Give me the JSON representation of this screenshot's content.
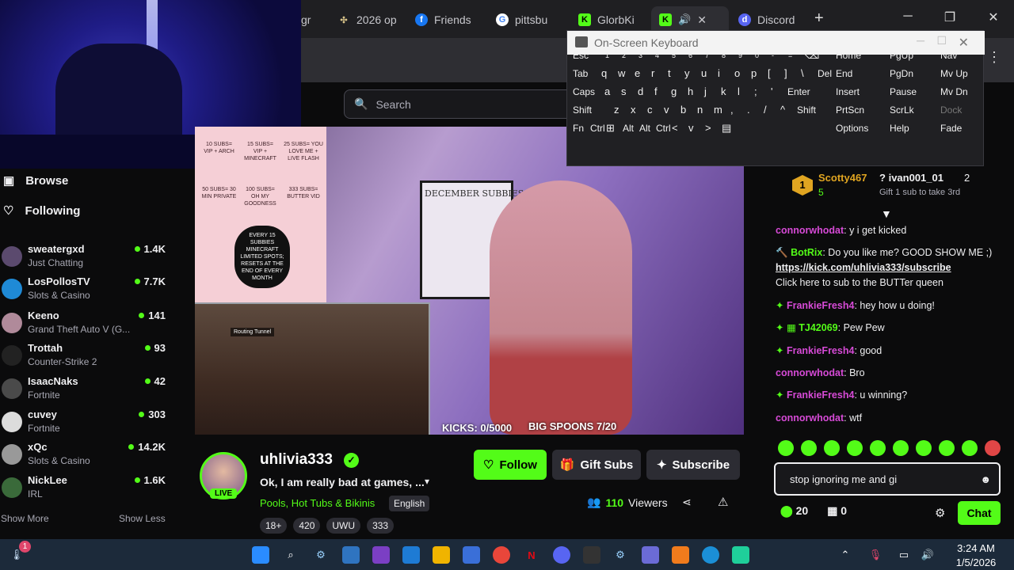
{
  "browser": {
    "tabs": [
      {
        "label": "gr",
        "icon": "page-icon"
      },
      {
        "label": "2026 op",
        "icon": "compass-icon"
      },
      {
        "label": "Friends",
        "icon": "facebook-icon"
      },
      {
        "label": "pittsbu",
        "icon": "google-icon"
      },
      {
        "label": "GlorbKi",
        "icon": "kick-icon"
      },
      {
        "label": "",
        "icon": "kick-icon",
        "active": true
      },
      {
        "label": "Discord",
        "icon": "discord-icon"
      }
    ],
    "new_tab": "+",
    "window_controls": [
      "─",
      "❐",
      "✕"
    ]
  },
  "site": {
    "search_placeholder": "Search"
  },
  "sidebar": {
    "browse": "Browse",
    "following": "Following",
    "channels": [
      {
        "name": "sweatergxd",
        "category": "Just Chatting",
        "viewers": "1.4K",
        "color": "#5b4a6e"
      },
      {
        "name": "LosPollosTV",
        "category": "Slots & Casino",
        "viewers": "7.7K",
        "color": "#1f8ad6"
      },
      {
        "name": "Keeno",
        "category": "Grand Theft Auto V (G...",
        "viewers": "141",
        "color": "#b08a9a"
      },
      {
        "name": "Trottah",
        "category": "Counter-Strike 2",
        "viewers": "93",
        "color": "#222222"
      },
      {
        "name": "IsaacNaks",
        "category": "Fortnite",
        "viewers": "42",
        "color": "#4a4a4a"
      },
      {
        "name": "cuvey",
        "category": "Fortnite",
        "viewers": "303",
        "color": "#dcdcdc"
      },
      {
        "name": "xQc",
        "category": "Slots & Casino",
        "viewers": "14.2K",
        "color": "#999999"
      },
      {
        "name": "NickLee",
        "category": "IRL",
        "viewers": "1.6K",
        "color": "#3a6a3a"
      }
    ],
    "show_more": "Show More",
    "show_less": "Show Less"
  },
  "video_overlay": {
    "kicks": "KICKS: 0/5000",
    "spoons": "BIG SPOONS 7/20",
    "board_title": "DECEMBER SUBBIES",
    "game_label": "Routing Tunnel",
    "hearts": [
      "10 SUBS= VIP + ARCH",
      "15 SUBS= VIP + MINECRAFT",
      "25 SUBS= YOU LOVE ME + LIVE FLASH",
      "50 SUBS= 30 MIN PRIVATE",
      "100 SUBS= OH MY GOODNESS",
      "333 SUBS= BUTTER VID",
      "EVERY 15 SUBBIES MINECRAFT LIMITED SPOTS; RESETS AT THE END OF EVERY MONTH"
    ]
  },
  "stream": {
    "streamer": "uhlivia333",
    "live_badge": "LIVE",
    "title": "Ok, I am really bad at games, ...",
    "category": "Pools, Hot Tubs & Bikinis",
    "language": "English",
    "tags": [
      "18+",
      "420",
      "UWU",
      "333"
    ],
    "follow": "Follow",
    "gift_subs": "Gift Subs",
    "subscribe": "Subscribe",
    "viewers_count": "110",
    "viewers_label": "Viewers"
  },
  "chat": {
    "leaderboard": [
      {
        "name": "Scotty467",
        "rank": "1",
        "count": "5"
      },
      {
        "name": "ivan001_01",
        "count": "2"
      }
    ],
    "gift_prompt": "Gift 1 sub to take 3rd",
    "messages": [
      {
        "user": "connorwhodat",
        "text": "y i get kicked",
        "color": "#d64ad6"
      },
      {
        "user": "BotRix",
        "text": "Do you like me? GOOD SHOW ME ;)",
        "link": "https://kick.com/uhlivia333/subscribe",
        "extra": "Click here to sub to the BUTTer queen",
        "color": "#53fc18"
      },
      {
        "user": "FrankieFresh4",
        "text": "hey how u doing!",
        "color": "#d64ad6"
      },
      {
        "user": "TJ42069",
        "text": "Pew Pew",
        "color": "#53fc18"
      },
      {
        "user": "FrankieFresh4",
        "text": "good",
        "color": "#d64ad6"
      },
      {
        "user": "connorwhodat",
        "text": "Bro",
        "color": "#d64ad6"
      },
      {
        "user": "FrankieFresh4",
        "text": "u winning?",
        "color": "#d64ad6"
      },
      {
        "user": "connorwhodat",
        "text": "wtf",
        "color": "#d64ad6"
      }
    ],
    "input_value": "stop ignoring me and gi",
    "kicks_count": "20",
    "gift_count": "0",
    "chat_button": "Chat"
  },
  "osk": {
    "title": "On-Screen Keyboard",
    "rows": [
      [
        "Esc",
        "`",
        "1",
        "2",
        "3",
        "4",
        "5",
        "6",
        "7",
        "8",
        "9",
        "0",
        "-",
        "=",
        "⌫"
      ],
      [
        "Tab",
        "q",
        "w",
        "e",
        "r",
        "t",
        "y",
        "u",
        "i",
        "o",
        "p",
        "[",
        "]",
        "\\",
        "Del"
      ],
      [
        "Caps",
        "a",
        "s",
        "d",
        "f",
        "g",
        "h",
        "j",
        "k",
        "l",
        ";",
        "'",
        "Enter"
      ],
      [
        "Shift",
        "z",
        "x",
        "c",
        "v",
        "b",
        "n",
        "m",
        ",",
        ".",
        "/",
        "^",
        "Shift"
      ],
      [
        "Fn",
        "Ctrl",
        "⊞",
        "Alt",
        "Alt",
        "Ctrl",
        "<",
        "v",
        ">",
        "▤"
      ]
    ],
    "side": [
      [
        "Home",
        "PgUp",
        "Nav"
      ],
      [
        "End",
        "PgDn",
        "Mv Up"
      ],
      [
        "Insert",
        "Pause",
        "Mv Dn"
      ],
      [
        "PrtScn",
        "ScrLk",
        "Dock"
      ],
      [
        "Options",
        "Help",
        "Fade"
      ]
    ]
  },
  "taskbar": {
    "time": "3:24 AM",
    "date": "1/5/2026",
    "notif_count": "1"
  }
}
